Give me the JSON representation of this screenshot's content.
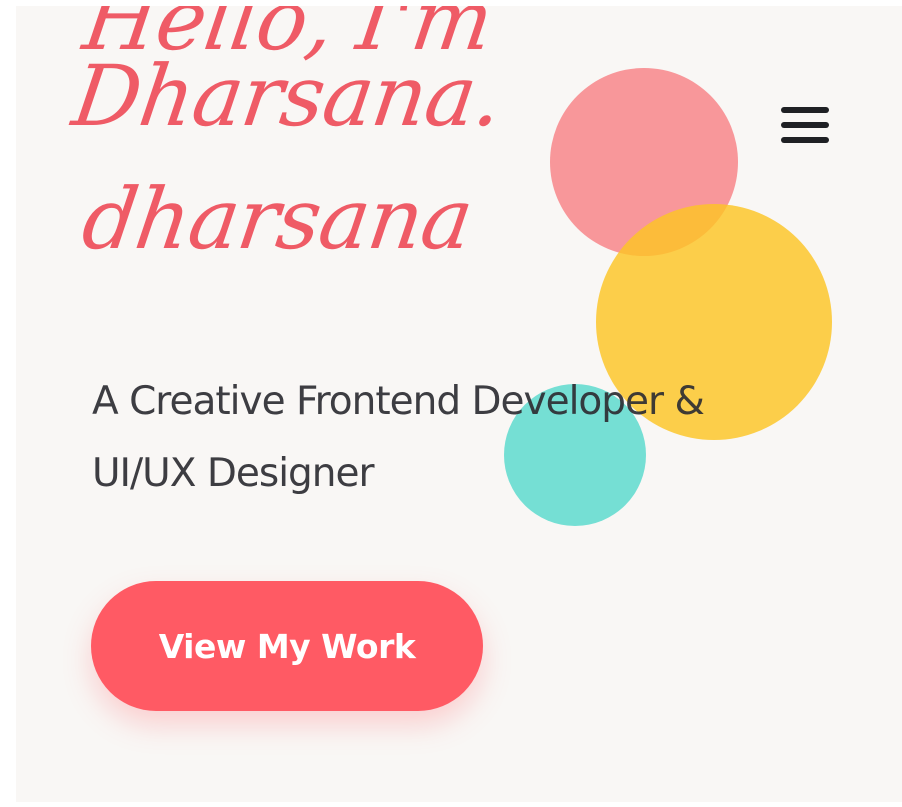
{
  "hero": {
    "greeting": "Hello, I'm Dharsana.",
    "name_script": "dharsana",
    "subtitle": "A Creative Frontend Developer & UI/UX Designer",
    "cta_label": "View My Work"
  },
  "header": {
    "menu_icon": "hamburger-menu-icon"
  },
  "colors": {
    "accent": "#ff5a64",
    "headline": "#ef5b66",
    "circle_pink": "#f8868a",
    "circle_yellow": "#fdc424",
    "circle_teal": "#66dcd0",
    "background": "#f9f7f5",
    "text": "#2e2e33"
  }
}
